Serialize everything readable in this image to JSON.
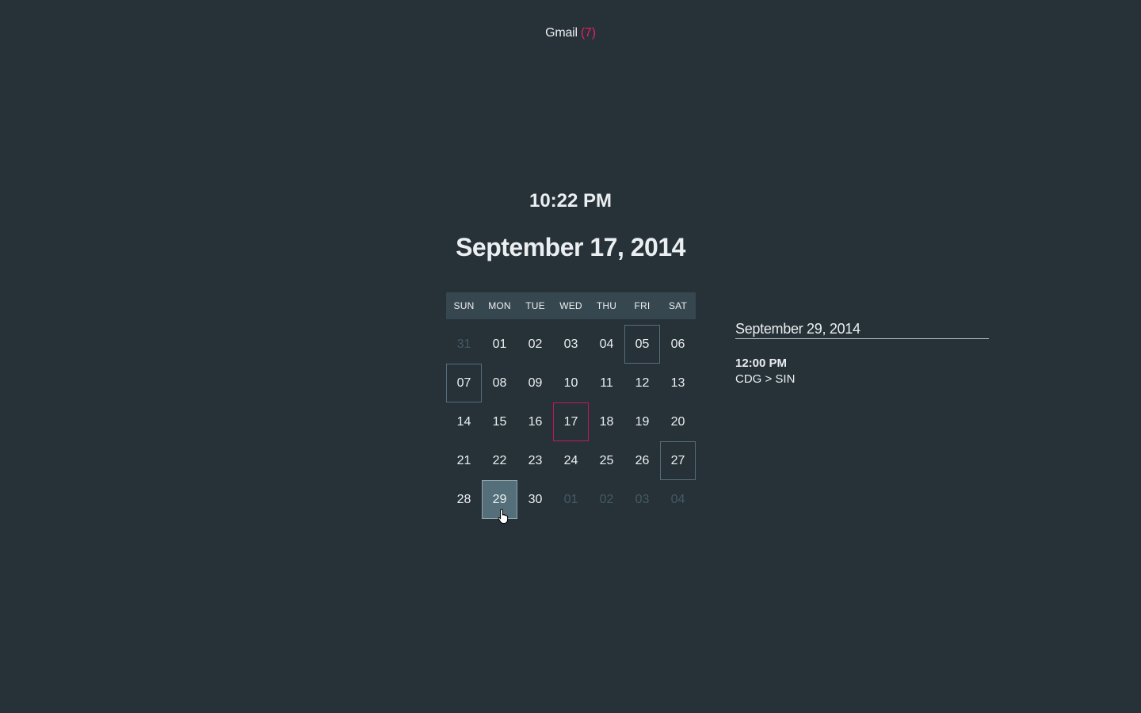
{
  "header": {
    "gmail_label": "Gmail",
    "gmail_count": "(7)"
  },
  "clock": {
    "time": "10:22 PM",
    "date": "September 17, 2014"
  },
  "calendar": {
    "weekdays": [
      "SUN",
      "MON",
      "TUE",
      "WED",
      "THU",
      "FRI",
      "SAT"
    ],
    "weeks": [
      [
        {
          "label": "31",
          "state": "other"
        },
        {
          "label": "01",
          "state": "normal"
        },
        {
          "label": "02",
          "state": "normal"
        },
        {
          "label": "03",
          "state": "normal"
        },
        {
          "label": "04",
          "state": "normal"
        },
        {
          "label": "05",
          "state": "event"
        },
        {
          "label": "06",
          "state": "normal"
        }
      ],
      [
        {
          "label": "07",
          "state": "event"
        },
        {
          "label": "08",
          "state": "normal"
        },
        {
          "label": "09",
          "state": "normal"
        },
        {
          "label": "10",
          "state": "normal"
        },
        {
          "label": "11",
          "state": "normal"
        },
        {
          "label": "12",
          "state": "normal"
        },
        {
          "label": "13",
          "state": "normal"
        }
      ],
      [
        {
          "label": "14",
          "state": "normal"
        },
        {
          "label": "15",
          "state": "normal"
        },
        {
          "label": "16",
          "state": "normal"
        },
        {
          "label": "17",
          "state": "today"
        },
        {
          "label": "18",
          "state": "normal"
        },
        {
          "label": "19",
          "state": "normal"
        },
        {
          "label": "20",
          "state": "normal"
        }
      ],
      [
        {
          "label": "21",
          "state": "normal"
        },
        {
          "label": "22",
          "state": "normal"
        },
        {
          "label": "23",
          "state": "normal"
        },
        {
          "label": "24",
          "state": "normal"
        },
        {
          "label": "25",
          "state": "normal"
        },
        {
          "label": "26",
          "state": "normal"
        },
        {
          "label": "27",
          "state": "event"
        }
      ],
      [
        {
          "label": "28",
          "state": "normal"
        },
        {
          "label": "29",
          "state": "selected"
        },
        {
          "label": "30",
          "state": "normal"
        },
        {
          "label": "01",
          "state": "other"
        },
        {
          "label": "02",
          "state": "other"
        },
        {
          "label": "03",
          "state": "other"
        },
        {
          "label": "04",
          "state": "other"
        }
      ]
    ]
  },
  "agenda": {
    "date": "September 29, 2014",
    "events": [
      {
        "time": "12:00 PM",
        "title": "CDG > SIN"
      }
    ]
  },
  "colors": {
    "background": "#263238",
    "header_bar": "#37474f",
    "accent": "#e91e63",
    "today_border": "#c2185b",
    "selected_fill": "#546e7a"
  },
  "icons": {
    "cursor": "hand-pointer-icon"
  }
}
